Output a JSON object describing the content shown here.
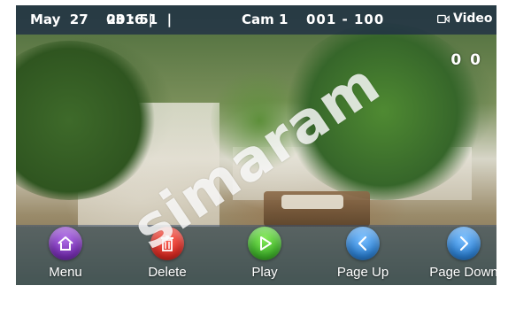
{
  "topbar": {
    "date": "May  27    2016 |",
    "time": "03 : 51  |",
    "camera": "Cam 1",
    "range": "001 - 100",
    "mode": "Video"
  },
  "counter": "0 0",
  "watermark": "simaram",
  "buttons": [
    {
      "label": "Menu",
      "icon": "home-icon",
      "color": "#8a3fc4"
    },
    {
      "label": "Delete",
      "icon": "trash-icon",
      "color": "#e0332d"
    },
    {
      "label": "Play",
      "icon": "play-icon",
      "color": "#43b82e"
    },
    {
      "label": "Page Up",
      "icon": "chevron-left-icon",
      "color": "#2f86d8"
    },
    {
      "label": "Page Down",
      "icon": "chevron-right-icon",
      "color": "#2f86d8"
    }
  ]
}
